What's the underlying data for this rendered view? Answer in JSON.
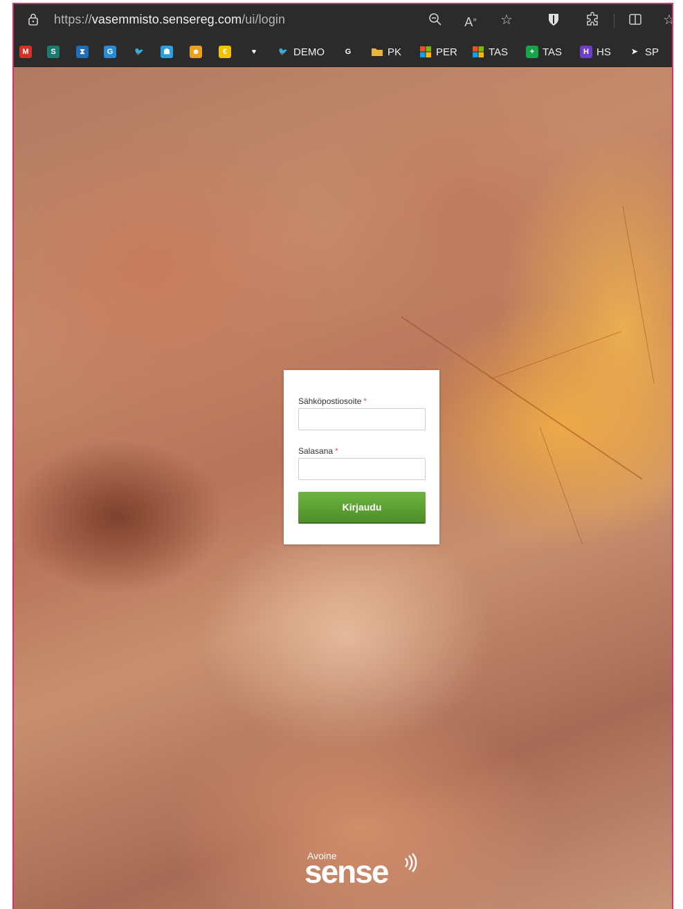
{
  "browser": {
    "url_scheme": "https://",
    "url_host": "vasemmisto.sensereg.com",
    "url_path": "/ui/login"
  },
  "bookmarks": [
    {
      "icon": "gmail-icon",
      "label": "",
      "color": "#d93025",
      "glyph": "M"
    },
    {
      "icon": "sharepoint-icon",
      "label": "",
      "color": "#1b7b6e",
      "glyph": "S"
    },
    {
      "icon": "hourglass-icon",
      "label": "",
      "color": "#1d6fb8",
      "glyph": "⧗"
    },
    {
      "icon": "g-icon",
      "label": "",
      "color": "#2a8bd4",
      "glyph": "G"
    },
    {
      "icon": "bird-icon",
      "label": "",
      "color": "#2b2b2b",
      "glyph": "🐦"
    },
    {
      "icon": "city-icon",
      "label": "",
      "color": "#2aa1de",
      "glyph": "☗"
    },
    {
      "icon": "face-icon",
      "label": "",
      "color": "#e8a21a",
      "glyph": "☻"
    },
    {
      "icon": "coin-icon",
      "label": "",
      "color": "#f2c200",
      "glyph": "€"
    },
    {
      "icon": "lips-icon",
      "label": "",
      "color": "#2b2b2b",
      "glyph": "♥"
    },
    {
      "icon": "bird-icon",
      "label": "DEMO",
      "color": "#2b2b2b",
      "glyph": "🐦"
    },
    {
      "icon": "g-dark-icon",
      "label": "",
      "color": "#2b2b2b",
      "glyph": "G"
    },
    {
      "icon": "folder-icon",
      "label": "PK",
      "color": "#e7b73d",
      "glyph": ""
    },
    {
      "icon": "windows-icon",
      "label": "PER",
      "color": "#2b2b2b",
      "glyph": ""
    },
    {
      "icon": "windows-icon",
      "label": "TAS",
      "color": "#2b2b2b",
      "glyph": ""
    },
    {
      "icon": "plus-cross-icon",
      "label": "TAS",
      "color": "#16a34a",
      "glyph": "+"
    },
    {
      "icon": "h-icon",
      "label": "HS",
      "color": "#6d3fc4",
      "glyph": "H"
    },
    {
      "icon": "telegram-icon",
      "label": "SP",
      "color": "#2b2b2b",
      "glyph": "➤"
    }
  ],
  "login": {
    "email_label": "Sähköpostiosoite",
    "password_label": "Salasana",
    "required_mark": "*",
    "email_value": "",
    "password_value": "",
    "submit_label": "Kirjaudu"
  },
  "brand": {
    "small": "Avoine",
    "big": "sense"
  },
  "colors": {
    "accent_green": "#5a9e32",
    "frame_border": "#d6336c",
    "required": "#d9534f"
  }
}
